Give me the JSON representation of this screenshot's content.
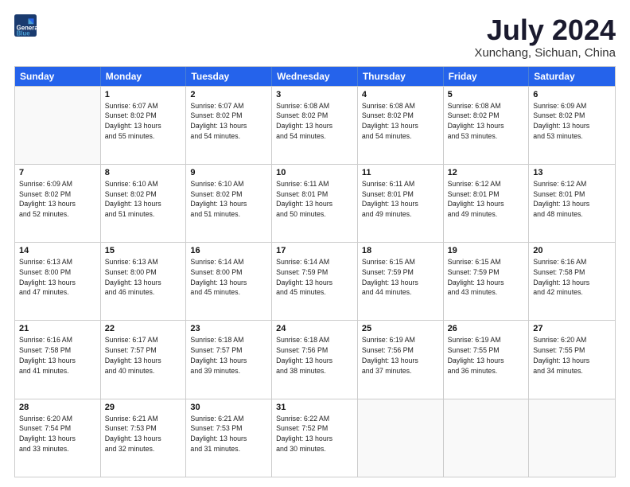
{
  "header": {
    "logo_line1": "General",
    "logo_line2": "Blue",
    "month": "July 2024",
    "location": "Xunchang, Sichuan, China"
  },
  "weekdays": [
    "Sunday",
    "Monday",
    "Tuesday",
    "Wednesday",
    "Thursday",
    "Friday",
    "Saturday"
  ],
  "rows": [
    [
      {
        "day": "",
        "info": ""
      },
      {
        "day": "1",
        "info": "Sunrise: 6:07 AM\nSunset: 8:02 PM\nDaylight: 13 hours\nand 55 minutes."
      },
      {
        "day": "2",
        "info": "Sunrise: 6:07 AM\nSunset: 8:02 PM\nDaylight: 13 hours\nand 54 minutes."
      },
      {
        "day": "3",
        "info": "Sunrise: 6:08 AM\nSunset: 8:02 PM\nDaylight: 13 hours\nand 54 minutes."
      },
      {
        "day": "4",
        "info": "Sunrise: 6:08 AM\nSunset: 8:02 PM\nDaylight: 13 hours\nand 54 minutes."
      },
      {
        "day": "5",
        "info": "Sunrise: 6:08 AM\nSunset: 8:02 PM\nDaylight: 13 hours\nand 53 minutes."
      },
      {
        "day": "6",
        "info": "Sunrise: 6:09 AM\nSunset: 8:02 PM\nDaylight: 13 hours\nand 53 minutes."
      }
    ],
    [
      {
        "day": "7",
        "info": "Sunrise: 6:09 AM\nSunset: 8:02 PM\nDaylight: 13 hours\nand 52 minutes."
      },
      {
        "day": "8",
        "info": "Sunrise: 6:10 AM\nSunset: 8:02 PM\nDaylight: 13 hours\nand 51 minutes."
      },
      {
        "day": "9",
        "info": "Sunrise: 6:10 AM\nSunset: 8:02 PM\nDaylight: 13 hours\nand 51 minutes."
      },
      {
        "day": "10",
        "info": "Sunrise: 6:11 AM\nSunset: 8:01 PM\nDaylight: 13 hours\nand 50 minutes."
      },
      {
        "day": "11",
        "info": "Sunrise: 6:11 AM\nSunset: 8:01 PM\nDaylight: 13 hours\nand 49 minutes."
      },
      {
        "day": "12",
        "info": "Sunrise: 6:12 AM\nSunset: 8:01 PM\nDaylight: 13 hours\nand 49 minutes."
      },
      {
        "day": "13",
        "info": "Sunrise: 6:12 AM\nSunset: 8:01 PM\nDaylight: 13 hours\nand 48 minutes."
      }
    ],
    [
      {
        "day": "14",
        "info": "Sunrise: 6:13 AM\nSunset: 8:00 PM\nDaylight: 13 hours\nand 47 minutes."
      },
      {
        "day": "15",
        "info": "Sunrise: 6:13 AM\nSunset: 8:00 PM\nDaylight: 13 hours\nand 46 minutes."
      },
      {
        "day": "16",
        "info": "Sunrise: 6:14 AM\nSunset: 8:00 PM\nDaylight: 13 hours\nand 45 minutes."
      },
      {
        "day": "17",
        "info": "Sunrise: 6:14 AM\nSunset: 7:59 PM\nDaylight: 13 hours\nand 45 minutes."
      },
      {
        "day": "18",
        "info": "Sunrise: 6:15 AM\nSunset: 7:59 PM\nDaylight: 13 hours\nand 44 minutes."
      },
      {
        "day": "19",
        "info": "Sunrise: 6:15 AM\nSunset: 7:59 PM\nDaylight: 13 hours\nand 43 minutes."
      },
      {
        "day": "20",
        "info": "Sunrise: 6:16 AM\nSunset: 7:58 PM\nDaylight: 13 hours\nand 42 minutes."
      }
    ],
    [
      {
        "day": "21",
        "info": "Sunrise: 6:16 AM\nSunset: 7:58 PM\nDaylight: 13 hours\nand 41 minutes."
      },
      {
        "day": "22",
        "info": "Sunrise: 6:17 AM\nSunset: 7:57 PM\nDaylight: 13 hours\nand 40 minutes."
      },
      {
        "day": "23",
        "info": "Sunrise: 6:18 AM\nSunset: 7:57 PM\nDaylight: 13 hours\nand 39 minutes."
      },
      {
        "day": "24",
        "info": "Sunrise: 6:18 AM\nSunset: 7:56 PM\nDaylight: 13 hours\nand 38 minutes."
      },
      {
        "day": "25",
        "info": "Sunrise: 6:19 AM\nSunset: 7:56 PM\nDaylight: 13 hours\nand 37 minutes."
      },
      {
        "day": "26",
        "info": "Sunrise: 6:19 AM\nSunset: 7:55 PM\nDaylight: 13 hours\nand 36 minutes."
      },
      {
        "day": "27",
        "info": "Sunrise: 6:20 AM\nSunset: 7:55 PM\nDaylight: 13 hours\nand 34 minutes."
      }
    ],
    [
      {
        "day": "28",
        "info": "Sunrise: 6:20 AM\nSunset: 7:54 PM\nDaylight: 13 hours\nand 33 minutes."
      },
      {
        "day": "29",
        "info": "Sunrise: 6:21 AM\nSunset: 7:53 PM\nDaylight: 13 hours\nand 32 minutes."
      },
      {
        "day": "30",
        "info": "Sunrise: 6:21 AM\nSunset: 7:53 PM\nDaylight: 13 hours\nand 31 minutes."
      },
      {
        "day": "31",
        "info": "Sunrise: 6:22 AM\nSunset: 7:52 PM\nDaylight: 13 hours\nand 30 minutes."
      },
      {
        "day": "",
        "info": ""
      },
      {
        "day": "",
        "info": ""
      },
      {
        "day": "",
        "info": ""
      }
    ]
  ]
}
